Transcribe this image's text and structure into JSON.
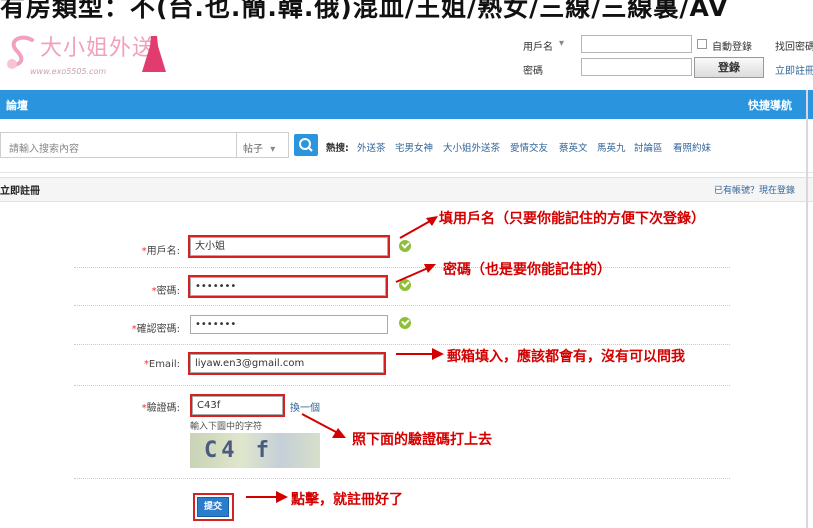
{
  "banner": {
    "text": "有房類型：不(台.也.簡.韓.俄)混血/王姐/熟女/三線/三線裏/AV"
  },
  "logo": {
    "text": "大小姐外送",
    "url": "www.exo5505.com"
  },
  "login": {
    "username_label": "用戶名",
    "username_caret": "▾",
    "password_label": "密碼",
    "auto_login": "自動登錄",
    "find_password": "找回密碼",
    "login_button": "登錄",
    "register_link": "立即註冊"
  },
  "nav": {
    "forum": "論壇",
    "quick_nav": "快捷導航"
  },
  "search": {
    "placeholder": "請輸入搜索內容",
    "type": "帖子",
    "hot_label": "熱搜:",
    "hot_terms": [
      "外送茶",
      "宅男女神",
      "大小姐外送茶",
      "愛情交友",
      "蔡英文",
      "馬英九",
      "討論區",
      "看照約妹"
    ]
  },
  "register": {
    "title": "立即註冊",
    "already_have": "已有帳號？現在登錄"
  },
  "form": {
    "required_mark": "*",
    "username_label": "用戶名:",
    "username_value": "大小姐",
    "password_label": "密碼:",
    "password_value": "•••••••",
    "confirm_label": "確認密碼:",
    "confirm_value": "•••••••",
    "email_label": "Email:",
    "email_value": "liyaw.en3@gmail.com",
    "captcha_label": "驗證碼:",
    "captcha_value": "C43f",
    "captcha_refresh": "換一個",
    "captcha_hint": "輸入下圖中的字符",
    "captcha_image_text": "C4 f",
    "submit_label": "提交"
  },
  "annotations": {
    "username_note": "填用戶名（只要你能記住的方便下次登錄）",
    "password_note": "密碼（也是要你能記住的）",
    "email_note": "郵箱填入，應該都會有，沒有可以問我",
    "captcha_note": "照下面的驗證碼打上去",
    "submit_note": "點擊，就註冊好了"
  },
  "colors": {
    "nav_blue": "#2a95de",
    "annotation_red": "#d40000",
    "check_green": "#8fbf3a"
  }
}
